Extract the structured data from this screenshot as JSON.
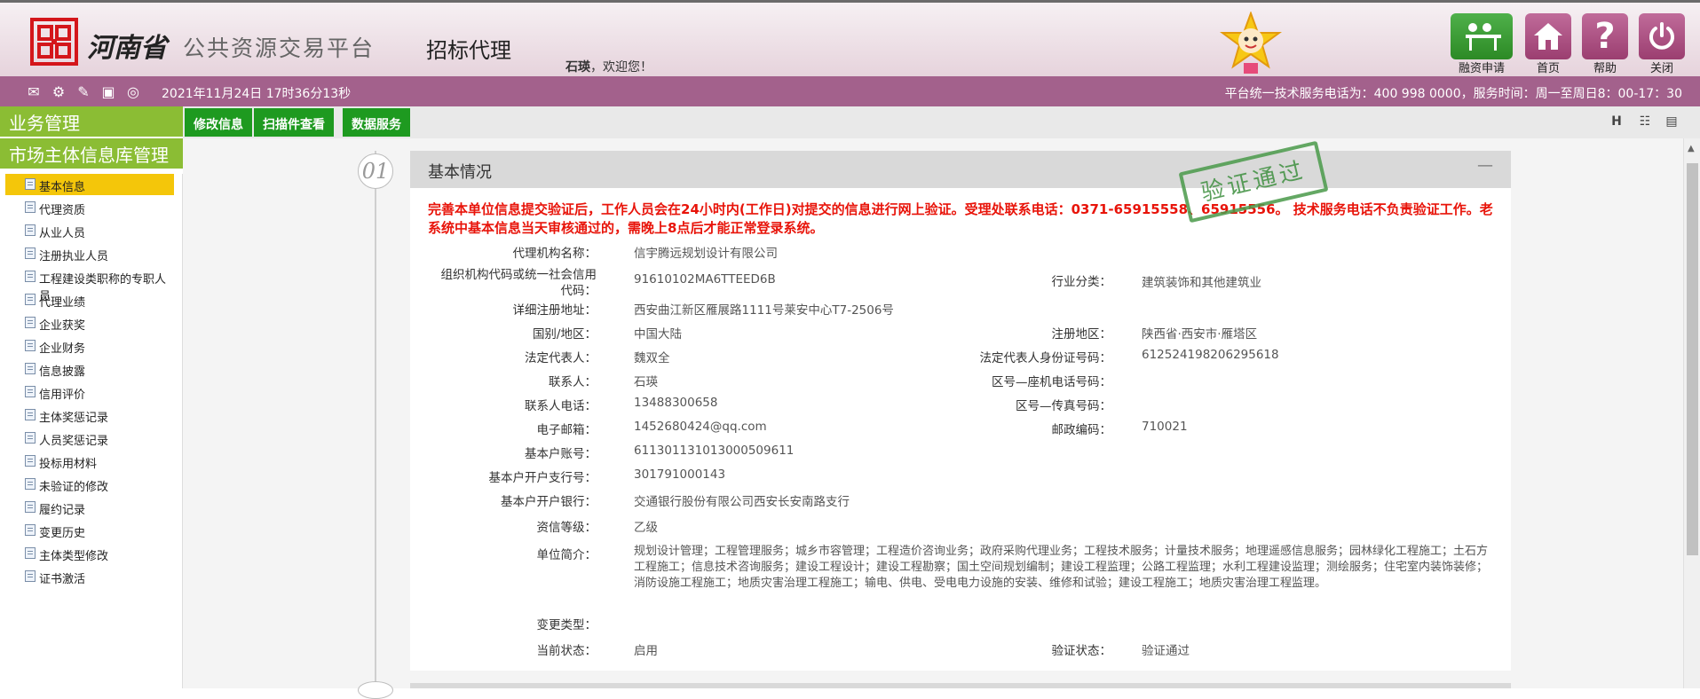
{
  "header": {
    "province": "河南省",
    "platform": "公共资源交易平台",
    "module": "招标代理",
    "user_name": "石瑛",
    "welcome_suffix": "，欢迎您！"
  },
  "toolbar": {
    "financing_label": "融资申请",
    "home_label": "首页",
    "help_label": "帮助",
    "close_label": "关闭"
  },
  "statusbar": {
    "datetime": "2021年11月24日 17时36分13秒",
    "service_info": "平台统一技术服务电话为：400 998 0000，服务时间：周一至周日8：00-17：30"
  },
  "sidebar": {
    "section1": "业务管理",
    "section2": "市场主体信息库管理",
    "items": [
      "基本信息",
      "代理资质",
      "从业人员",
      "注册执业人员",
      "工程建设类职称的专职人员",
      "代理业绩",
      "企业获奖",
      "企业财务",
      "信息披露",
      "信用评价",
      "主体奖惩记录",
      "人员奖惩记录",
      "投标用材料",
      "未验证的修改",
      "履约记录",
      "变更历史",
      "主体类型修改",
      "证书激活"
    ]
  },
  "tabs": {
    "edit": "修改信息",
    "scan": "扫描件查看",
    "data": "数据服务"
  },
  "step": {
    "number": "01"
  },
  "panel": {
    "title": "基本情况",
    "stamp": "验证通过",
    "notice": "完善本单位信息提交验证后，工作人员会在24小时内(工作日)对提交的信息进行网上验证。受理处联系电话：0371-65915558、65915556。 技术服务电话不负责验证工作。老系统中基本信息当天审核通过的，需晚上8点后才能正常登录系统。"
  },
  "fields": {
    "agency_name_label": "代理机构名称：",
    "agency_name": "信宇腾远规划设计有限公司",
    "org_code_label_1": "组织机构代码或统一社会信用",
    "org_code_label_2": "代码：",
    "org_code": "91610102MA6TTEED6B",
    "industry_label": "行业分类：",
    "industry": "建筑装饰和其他建筑业",
    "address_label": "详细注册地址：",
    "address": "西安曲江新区雁展路1111号莱安中心T7-2506号",
    "country_label": "国别/地区：",
    "country": "中国大陆",
    "region_label": "注册地区：",
    "region": "陕西省·西安市·雁塔区",
    "legal_rep_label": "法定代表人：",
    "legal_rep": "魏双全",
    "legal_id_label": "法定代表人身份证号码：",
    "legal_id": "612524198206295618",
    "contact_label": "联系人：",
    "contact": "石瑛",
    "landline_label": "区号—座机电话号码：",
    "landline": "",
    "contact_phone_label": "联系人电话：",
    "contact_phone": "13488300658",
    "fax_label": "区号—传真号码：",
    "fax": "",
    "email_label": "电子邮箱：",
    "email": "1452680424@qq.com",
    "postcode_label": "邮政编码：",
    "postcode": "710021",
    "account_label": "基本户账号：",
    "account": "611301131013000509611",
    "branch_no_label": "基本户开户支行号：",
    "branch_no": "301791000143",
    "bank_label": "基本户开户银行：",
    "bank": "交通银行股份有限公司西安长安南路支行",
    "credit_label": "资信等级：",
    "credit": "乙级",
    "intro_label": "单位简介：",
    "intro": "规划设计管理；工程管理服务；城乡市容管理；工程造价咨询业务；政府采购代理业务；工程技术服务；计量技术服务；地理遥感信息服务；园林绿化工程施工；土石方工程施工；信息技术咨询服务；建设工程设计；建设工程勘察；国土空间规划编制；建设工程监理；公路工程监理；水利工程建设监理；测绘服务；住宅室内装饰装修；消防设施工程施工；地质灾害治理工程施工；输电、供电、受电电力设施的安装、维修和试验；建设工程施工；地质灾害治理工程监理。",
    "change_type_label": "变更类型：",
    "change_type": "",
    "current_status_label": "当前状态：",
    "current_status": "启用",
    "verify_status_label": "验证状态：",
    "verify_status": "验证通过"
  },
  "colors": {
    "status_bar": "#a3618c",
    "sidebar_green": "#8bbd34",
    "tab_green": "#1e9a20",
    "active_item": "#f4c60a",
    "notice_red": "#e8140a"
  }
}
